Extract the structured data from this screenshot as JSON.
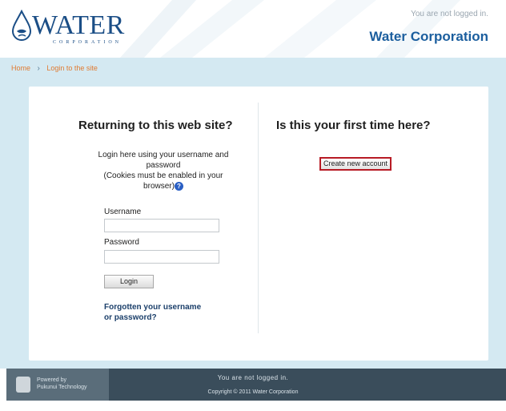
{
  "header": {
    "logo_text": "WATER",
    "logo_subtext": "CORPORATION",
    "login_info": "You are not logged in.",
    "site_name": "Water Corporation"
  },
  "breadcrumb": {
    "home": "Home",
    "separator": "›",
    "current": "Login to the site"
  },
  "login": {
    "title": "Returning to this web site?",
    "desc_line1": "Login here using your username and",
    "desc_line2": "password",
    "desc_line3": "(Cookies must be enabled in your",
    "desc_line4": "browser)",
    "help_icon": "?",
    "username_label": "Username",
    "username_value": "",
    "password_label": "Password",
    "password_value": "",
    "login_button": "Login",
    "forgot_line1": "Forgotten your username",
    "forgot_line2": "or password?"
  },
  "signup": {
    "title": "Is this your first time here?",
    "create_button": "Create new account"
  },
  "footer": {
    "powered_line1": "Powered by",
    "powered_line2": "Pukunui Technology",
    "login_info": "You are not logged in.",
    "copyright": "Copyright © 2011 Water Corporation"
  },
  "colors": {
    "brand_blue": "#1b5e9e",
    "nav_bg": "#d4e9f2",
    "breadcrumb_orange": "#e07b32",
    "footer_bg": "#3a4d5b",
    "highlight_red": "#b81b25"
  }
}
